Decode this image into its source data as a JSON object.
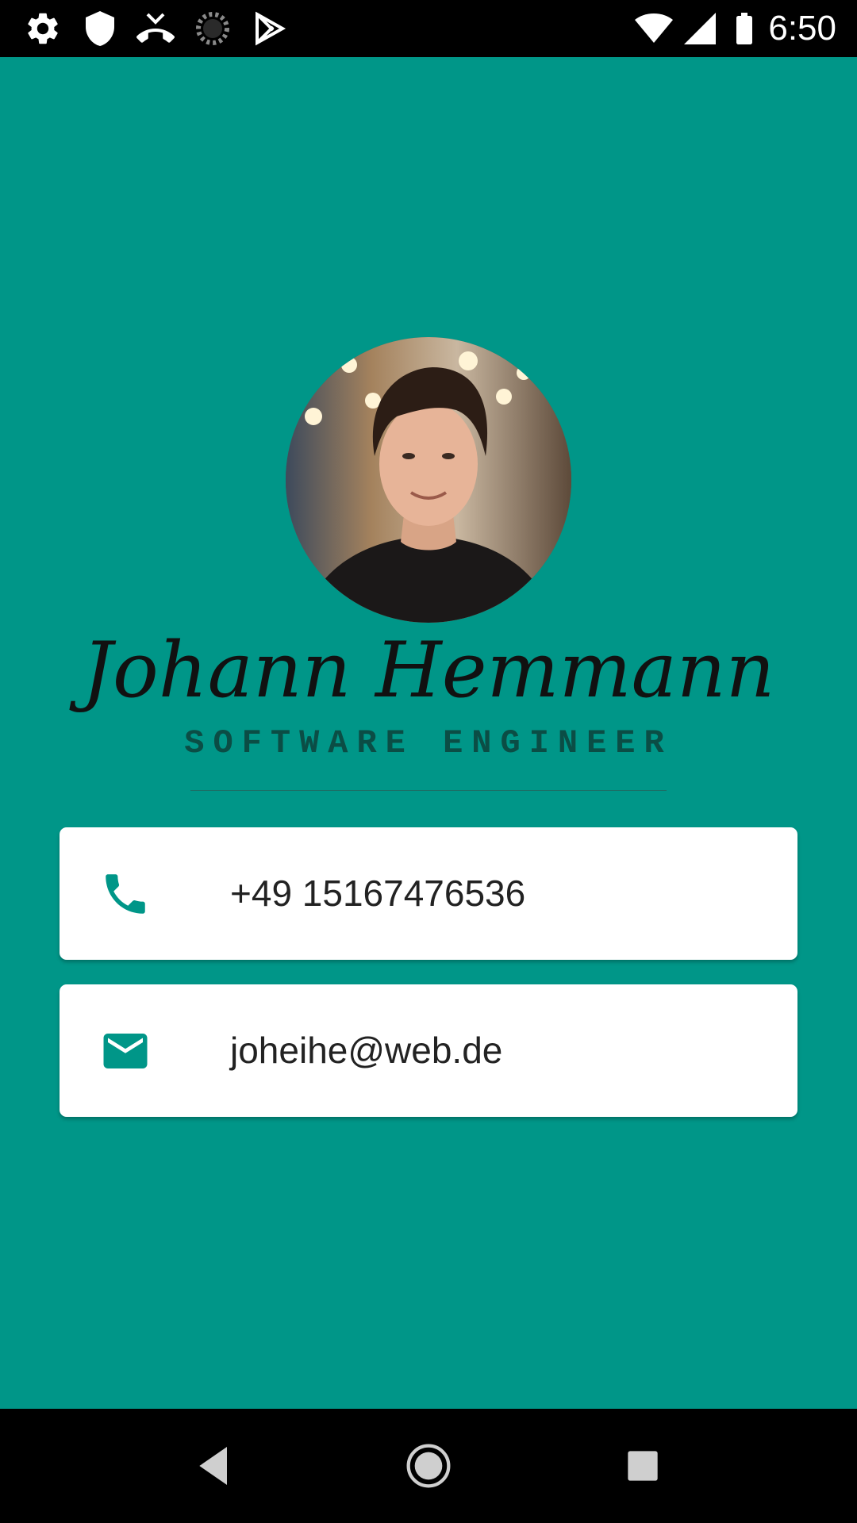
{
  "status_bar": {
    "time": "6:50",
    "left_icons": [
      "settings-icon",
      "shield-icon",
      "missed-call-icon",
      "sync-spinner-icon",
      "play-store-icon"
    ],
    "right_icons": [
      "wifi-icon",
      "cell-signal-icon",
      "battery-icon"
    ]
  },
  "profile": {
    "name": "Johann Hemmann",
    "title": "SOFTWARE ENGINEER",
    "avatar": "profile-photo"
  },
  "contacts": {
    "phone": {
      "icon": "phone-icon",
      "value": "+49 15167476536"
    },
    "email": {
      "icon": "email-icon",
      "value": "joheihe@web.de"
    }
  },
  "nav_bar": {
    "buttons": [
      "back-icon",
      "home-icon",
      "recents-icon"
    ]
  },
  "colors": {
    "background": "#009688",
    "accent": "#009688",
    "card": "#ffffff",
    "title_text": "#0b4d45",
    "bars": "#000000"
  }
}
